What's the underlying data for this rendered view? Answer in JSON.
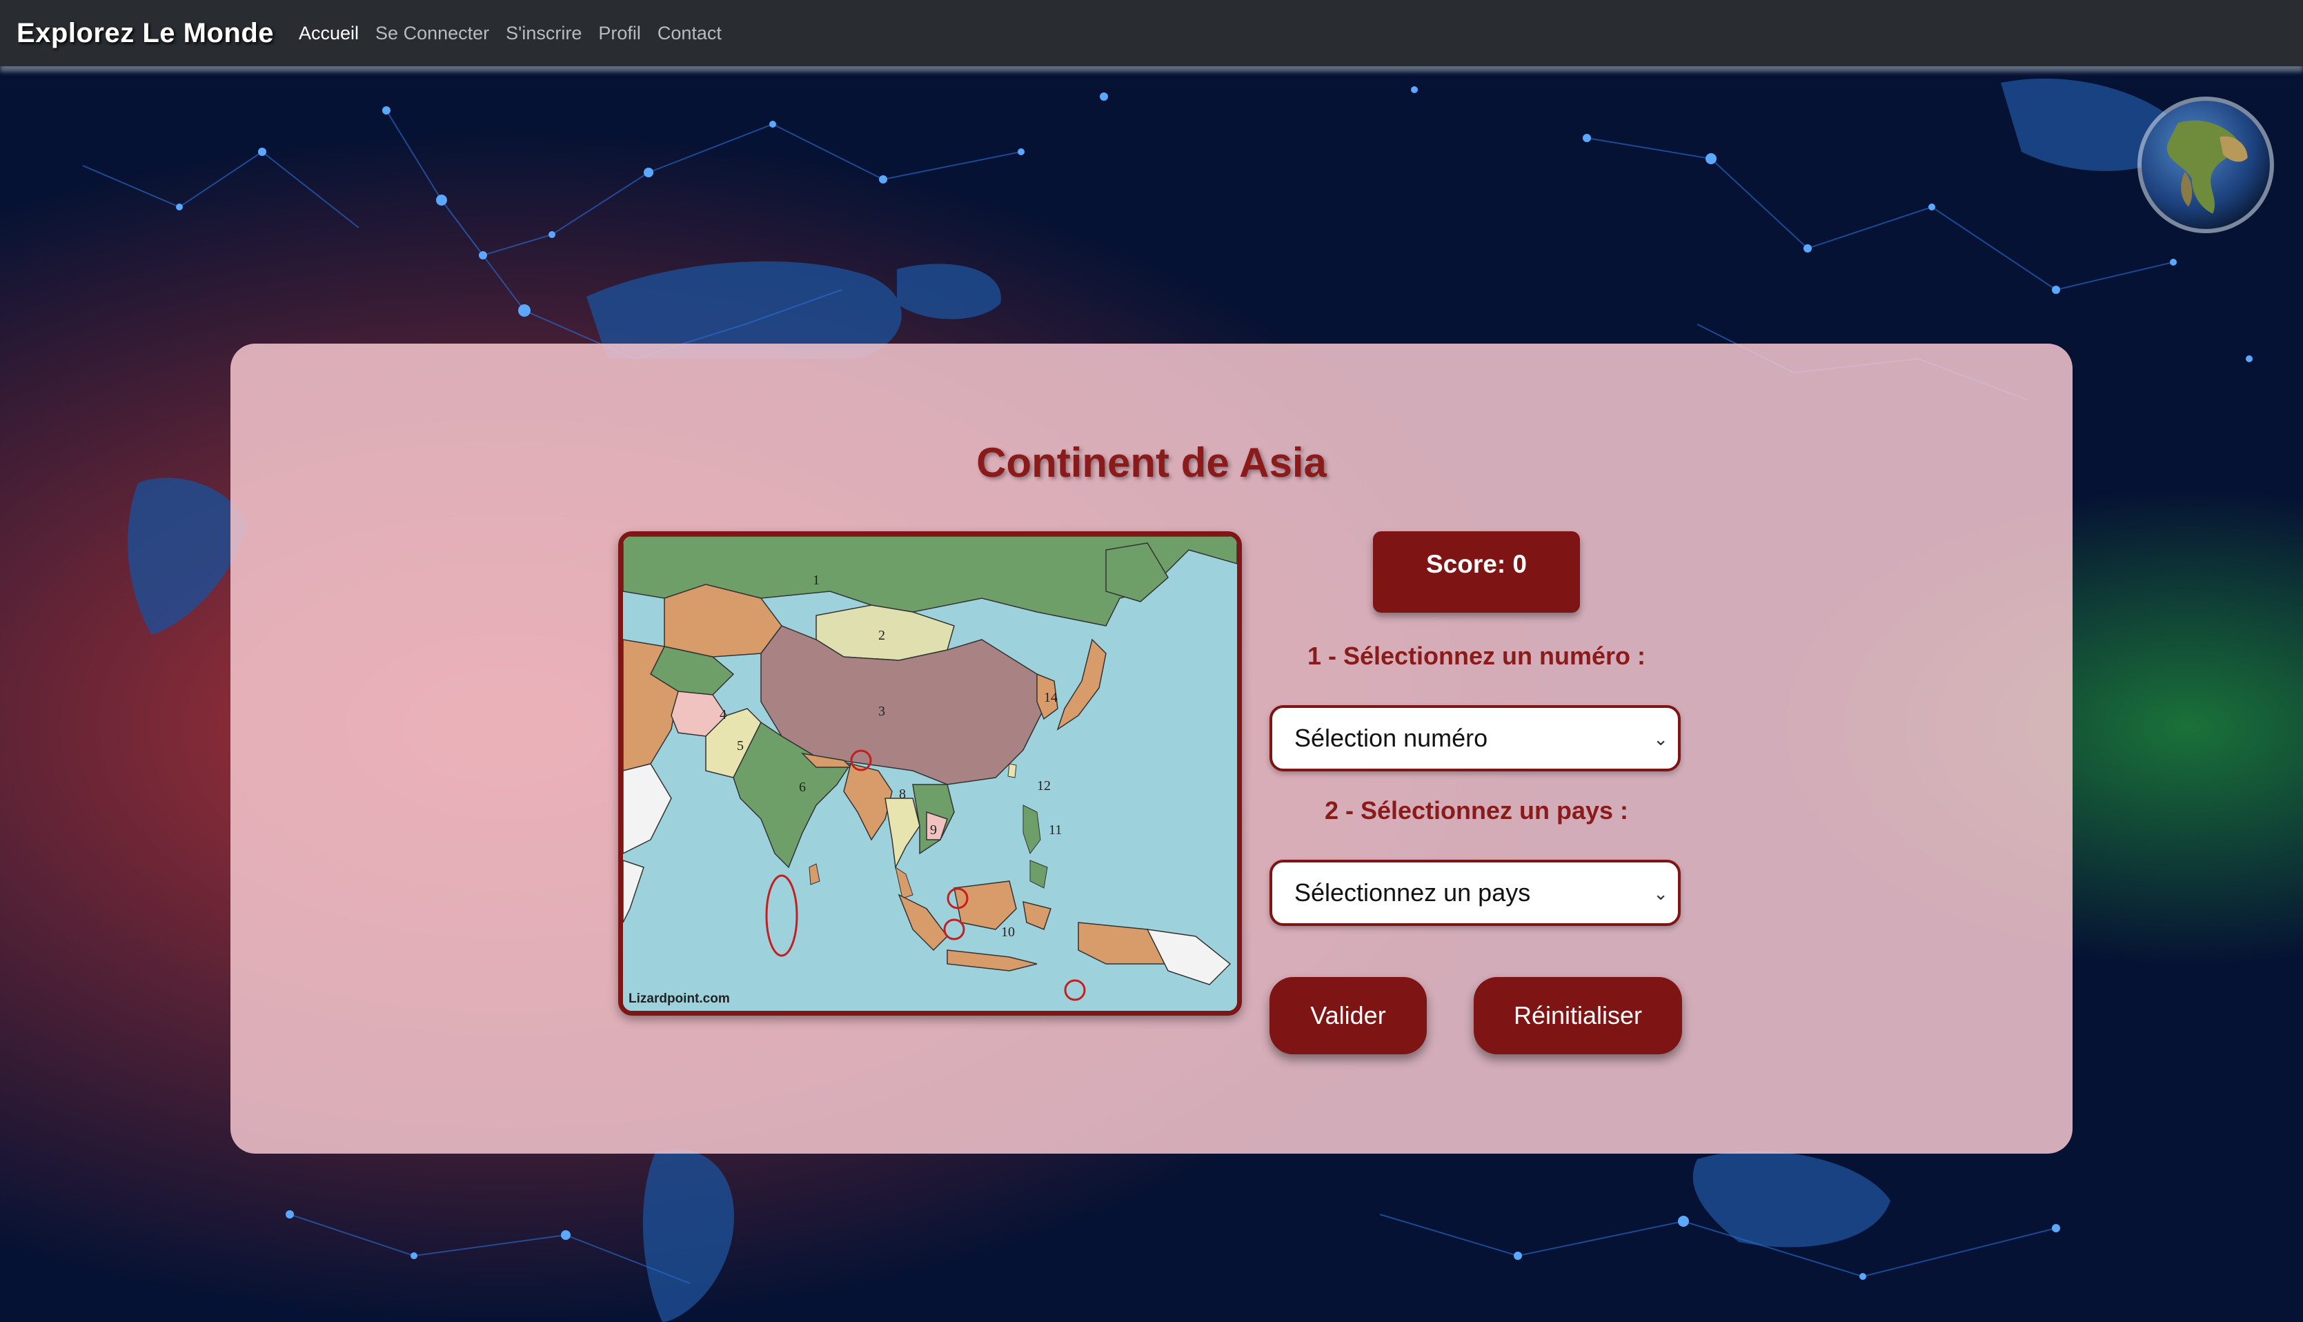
{
  "navbar": {
    "brand": "Explorez Le Monde",
    "links": [
      "Accueil",
      "Se Connecter",
      "S'inscrire",
      "Profil",
      "Contact"
    ],
    "active_link": "Accueil"
  },
  "quiz": {
    "title": "Continent de Asia",
    "score_label": "Score: 0",
    "step1_label": "1 - Sélectionnez un numéro :",
    "number_select": {
      "value": "Sélection numéro"
    },
    "step2_label": "2 - Sélectionnez un pays :",
    "country_select": {
      "value": "Sélectionnez un pays"
    },
    "validate_label": "Valider",
    "reset_label": "Réinitialiser"
  },
  "map": {
    "credit": "Lizardpoint.com",
    "numbers": [
      "1",
      "2",
      "3",
      "4",
      "5",
      "6",
      "8",
      "9",
      "10",
      "11",
      "12",
      "14"
    ]
  },
  "colors": {
    "navbar_bg": "#292d31",
    "accent": "#7f1414",
    "title": "#8b1a1a",
    "panel_bg": "#f5c6ce",
    "ocean": "#9dd2dc"
  },
  "icons": {
    "globe": "globe-icon",
    "select_chevron": "chevron-down-icon"
  }
}
